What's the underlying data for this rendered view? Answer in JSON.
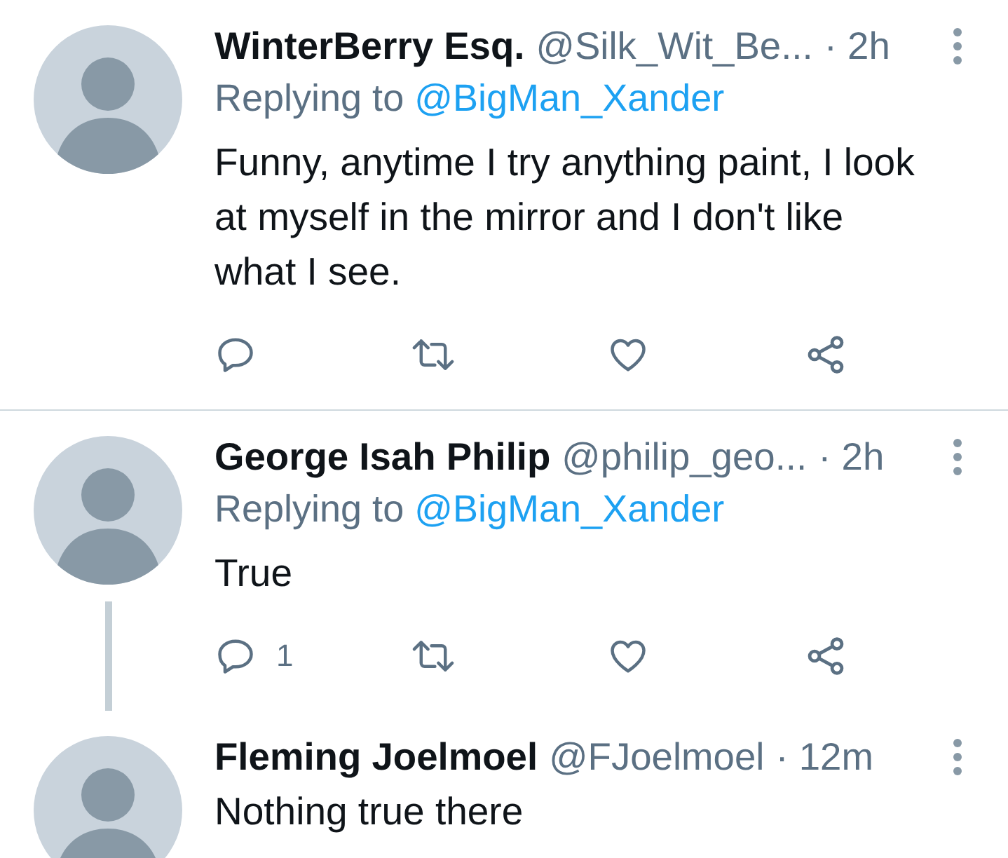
{
  "tweets": [
    {
      "name": "WinterBerry Esq.",
      "handle": "@Silk_Wit_Be...",
      "time": "· 2h",
      "replying": {
        "label": "Replying to",
        "handle": "@BigMan_Xander"
      },
      "text": "Funny, anytime I try anything paint, I look at myself in the mirror and I don't like what I see.",
      "thread_line": false,
      "divider": true,
      "show_actions": true
    },
    {
      "name": "George Isah Philip",
      "handle": "@philip_geo...",
      "time": "· 2h",
      "replying": {
        "label": "Replying to",
        "handle": "@BigMan_Xander"
      },
      "text": "True",
      "reply_count": "1",
      "thread_line": true,
      "divider": false,
      "show_actions": true
    },
    {
      "name": "Fleming Joelmoel",
      "handle": "@FJoelmoel",
      "time": "· 12m",
      "text": "Nothing true there"
    }
  ]
}
